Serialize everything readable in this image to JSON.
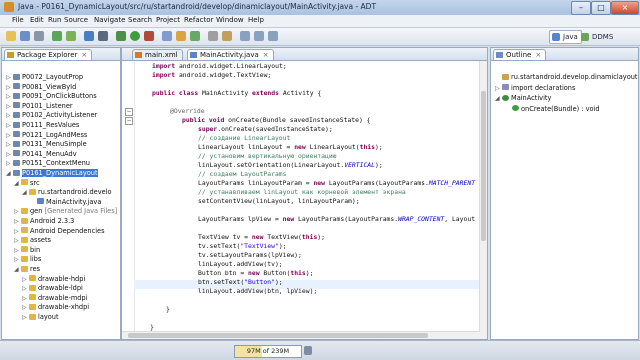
{
  "window": {
    "title": "Java - P0161_DynamicLayout/src/ru/startandroid/develop/dinamiclayout/MainActivity.java - ADT",
    "minimize": "–",
    "maximize": "□",
    "close": "×"
  },
  "menu": [
    "File",
    "Edit",
    "Run",
    "Source",
    "Navigate",
    "Search",
    "Project",
    "Refactor",
    "Window",
    "Help"
  ],
  "perspectives": {
    "java": "Java",
    "ddms": "DDMS"
  },
  "package_explorer": {
    "tab_label": "Package Explorer",
    "items": [
      {
        "label": "P0072_LayoutProp",
        "indent": 0
      },
      {
        "label": "P0081_ViewById",
        "indent": 0
      },
      {
        "label": "P0091_OnClickButtons",
        "indent": 0
      },
      {
        "label": "P0101_Listener",
        "indent": 0
      },
      {
        "label": "P0102_ActivityListener",
        "indent": 0
      },
      {
        "label": "P0111_ResValues",
        "indent": 0
      },
      {
        "label": "P0121_LogAndMess",
        "indent": 0
      },
      {
        "label": "P0131_MenuSimple",
        "indent": 0
      },
      {
        "label": "P0141_MenuAdv",
        "indent": 0
      },
      {
        "label": "P0151_ContextMenu",
        "indent": 0
      },
      {
        "label": "P0161_DynamicLayout",
        "indent": 0
      },
      {
        "label": "src",
        "indent": 1
      },
      {
        "label": "ru.startandroid.develo",
        "indent": 2
      },
      {
        "label": "MainActivity.java",
        "indent": 3
      },
      {
        "label": "gen",
        "suffix": "[Generated Java Files]",
        "indent": 1
      },
      {
        "label": "Android 2.3.3",
        "indent": 1
      },
      {
        "label": "Android Dependencies",
        "indent": 1
      },
      {
        "label": "assets",
        "indent": 1
      },
      {
        "label": "bin",
        "indent": 1
      },
      {
        "label": "libs",
        "indent": 1
      },
      {
        "label": "res",
        "indent": 1
      },
      {
        "label": "drawable-hdpi",
        "indent": 2
      },
      {
        "label": "drawable-ldpi",
        "indent": 2
      },
      {
        "label": "drawable-mdpi",
        "indent": 2
      },
      {
        "label": "drawable-xhdpi",
        "indent": 2
      },
      {
        "label": "layout",
        "indent": 2
      }
    ]
  },
  "editor": {
    "tabs": [
      "main.xml",
      "MainActivity.java"
    ],
    "code": {
      "l1_kw": "import",
      "l1": " android.widget.LinearLayout;",
      "l2_kw": "import",
      "l2": " android.widget.TextView;",
      "l3_kw1": "public class",
      "l3_a": " MainActivity ",
      "l3_kw2": "extends",
      "l3_b": " Activity {",
      "l4": "@Override",
      "l5_kw": "public void",
      "l5": " onCreate(Bundle savedInstanceState) {",
      "l6_kw": "super",
      "l6": ".onCreate(savedInstanceState);",
      "l7": "// создание LinearLayout",
      "l8_a": "LinearLayout linLayout = ",
      "l8_kw1": "new",
      "l8_b": " LinearLayout(",
      "l8_kw2": "this",
      "l8_c": ");",
      "l9": "// установим вертикальную ориентацию",
      "l10_a": "linLayout.setOrientation(LinearLayout.",
      "l10_it": "VERTICAL",
      "l10_b": ");",
      "l11": "// создаем LayoutParams",
      "l12_a": "LayoutParams linLayoutParam = ",
      "l12_kw": "new",
      "l12_b": " LayoutParams(LayoutParams.",
      "l12_it": "MATCH_PARENT",
      "l13": "// устанавливаем linLayout как корневой элемент экрана",
      "l14": "setContentView(linLayout, linLayoutParam);",
      "l15_a": "LayoutParams lpView = ",
      "l15_kw": "new",
      "l15_b": " LayoutParams(LayoutParams.",
      "l15_it": "WRAP_CONTENT",
      "l15_c": ", Layout",
      "l16_a": "TextView tv = ",
      "l16_kw1": "new",
      "l16_b": " TextView(",
      "l16_kw2": "this",
      "l16_c": ");",
      "l17_a": "tv.setText(",
      "l17_st": "\"TextView\"",
      "l17_b": ");",
      "l18": "tv.setLayoutParams(lpView);",
      "l19": "linLayout.addView(tv);",
      "l20_a": "Button btn = ",
      "l20_kw1": "new",
      "l20_b": " Button(",
      "l20_kw2": "this",
      "l20_c": ");",
      "l21_a": "btn.setText(",
      "l21_st": "\"Button\"",
      "l21_b": ");",
      "l22": "linLayout.addView(btn, lpView);",
      "l23": "}",
      "l24": "}"
    }
  },
  "outline": {
    "tab_label": "Outline",
    "items": [
      {
        "label": "ru.startandroid.develop.dinamiclayout",
        "indent": 0
      },
      {
        "label": "import declarations",
        "indent": 0
      },
      {
        "label": "MainActivity",
        "indent": 0
      },
      {
        "label": "onCreate(Bundle) : void",
        "indent": 1
      }
    ]
  },
  "status": {
    "heap": "97M of 239M",
    "heap_fraction": 0.41
  },
  "colors": {
    "selection": "#3a79d4",
    "keyword": "#7f0055",
    "comment": "#3f7f5f",
    "string": "#2a00ff"
  }
}
